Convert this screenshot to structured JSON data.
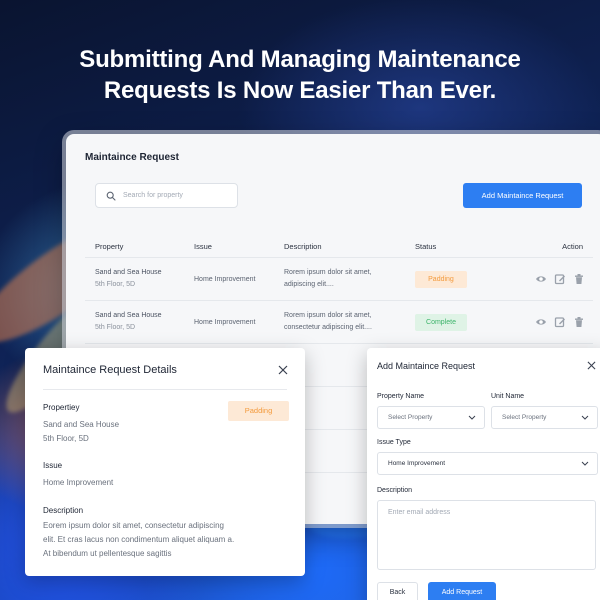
{
  "headline": {
    "line1": "Submitting And Managing Maintenance",
    "line2": "Requests Is Now Easier Than Ever."
  },
  "main": {
    "title": "Maintaince Request",
    "search_placeholder": "Search for property",
    "add_button": "Add Maintaince Request",
    "columns": [
      "Property",
      "Issue",
      "Description",
      "Status",
      "Action"
    ],
    "rows": [
      {
        "property": "Sand and Sea House",
        "unit": "5th Floor, 5D",
        "issue": "Home Improvement",
        "desc1": "Rorem ipsum dolor sit amet,",
        "desc2": "adipiscing elit....",
        "status": "Padding"
      },
      {
        "property": "Sand and Sea House",
        "unit": "5th Floor, 5D",
        "issue": "Home Improvement",
        "desc1": "Rorem ipsum dolor sit amet,",
        "desc2": "consectetur adipiscing elit....",
        "status": "Complete"
      }
    ]
  },
  "details": {
    "title": "Maintaince Request Details",
    "property_label": "Propertiey",
    "property_name": "Sand and Sea House",
    "property_unit": "5th Floor, 5D",
    "status": "Padding",
    "issue_label": "Issue",
    "issue_value": "Home Improvement",
    "description_label": "Description",
    "description_line1": "Eorem ipsum dolor sit amet, consectetur adipiscing",
    "description_line2": "elit. Et cras lacus non condimentum aliquet aliquam a.",
    "description_line3": "At bibendum ut pellentesque sagittis"
  },
  "form": {
    "title": "Add Maintaince Request",
    "property_name_label": "Property Name",
    "property_name_value": "Select Property",
    "unit_name_label": "Unit Name",
    "unit_name_value": "Select Property",
    "issue_type_label": "Issue Type",
    "issue_type_value": "Home Improvement",
    "description_label": "Description",
    "description_placeholder": "Enter email address",
    "back_button": "Back",
    "submit_button": "Add Request"
  },
  "colors": {
    "accent": "#2d7ef2",
    "pending_bg": "#fde9d6",
    "pending_text": "#f39a3d",
    "complete_bg": "#dff3e6",
    "complete_text": "#3cb46a"
  }
}
